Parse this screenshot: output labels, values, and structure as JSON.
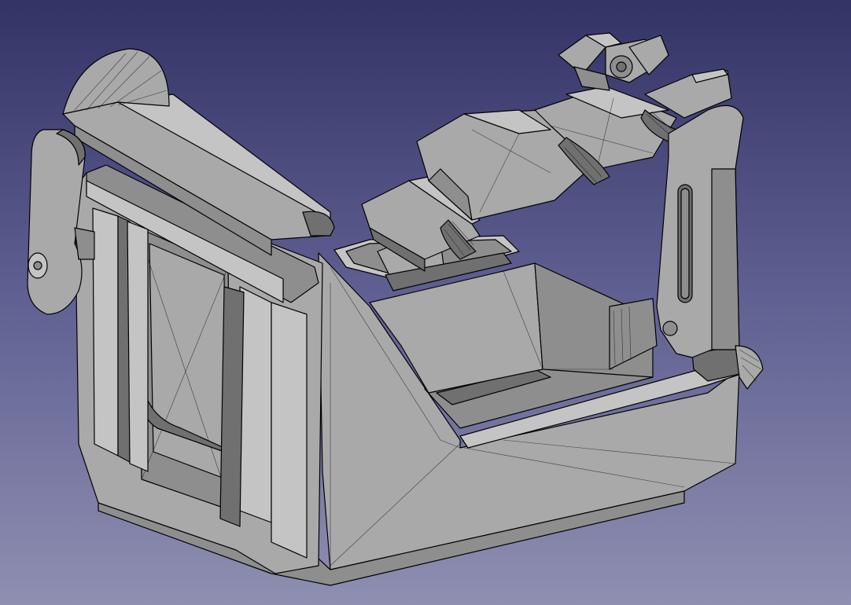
{
  "viewport": {
    "background_top": "#333366",
    "background_bottom": "#8f8fb2",
    "shading": "flat-lines",
    "model": "cad-bracket-assembly"
  },
  "colors": {
    "body": "#a9a9a9",
    "shadow": "#707070",
    "edges": "#000000"
  }
}
